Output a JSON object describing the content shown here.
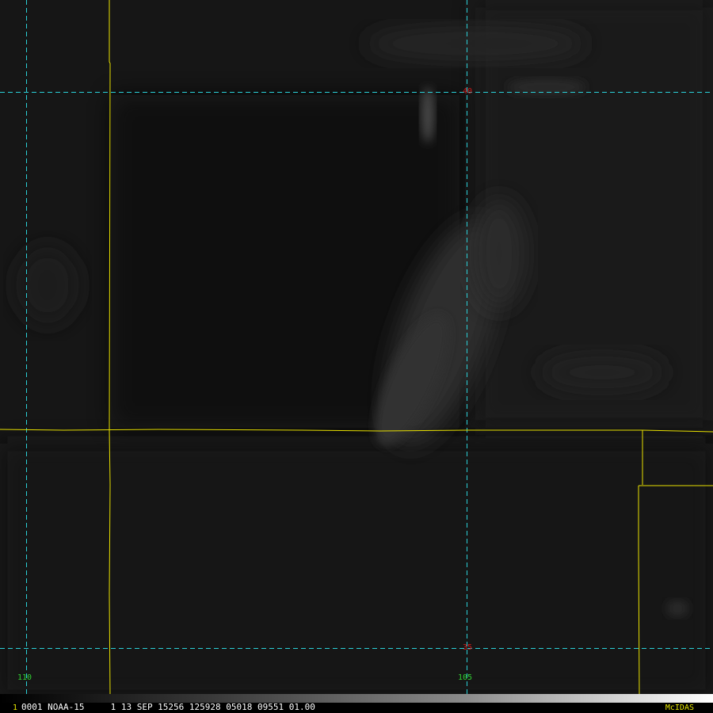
{
  "image": {
    "type": "satellite-visible-imagery",
    "colors": {
      "background": "#151515",
      "graticule": "#2ad0d8",
      "state_boundary": "#e8e000",
      "latitude_label": "#d01818",
      "longitude_label": "#30d030",
      "footer_text": "#ffffff",
      "logo_text": "#e8e800"
    }
  },
  "graticule": {
    "latitude_labels": [
      "40",
      "35"
    ],
    "longitude_labels": [
      "110",
      "105"
    ]
  },
  "footer": {
    "marker": "1",
    "info": "0001 NOAA-15     1 13 SEP 15256 125928 05018 09551 01.00",
    "logo": "McIDAS"
  }
}
